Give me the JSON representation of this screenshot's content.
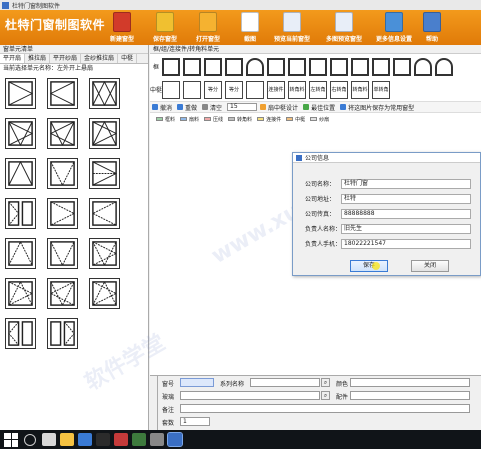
{
  "window": {
    "title": "杜特门窗制图软件"
  },
  "header": {
    "brand": "杜特门窗制图软件",
    "buttons": [
      {
        "label": "新建窗型",
        "color": "#d23b2a",
        "icon": "new-file-icon"
      },
      {
        "label": "保存窗型",
        "color": "#f0c030",
        "icon": "save-icon"
      },
      {
        "label": "打开窗型",
        "color": "#f5b230",
        "icon": "folder-icon"
      },
      {
        "label": "截图",
        "color": "#ffffff",
        "icon": "screenshot-icon"
      },
      {
        "label": "预览当前窗型",
        "color": "#e8eef8",
        "icon": "preview-icon"
      },
      {
        "label": "多图预览窗型",
        "color": "#e8eef8",
        "icon": "multi-preview-icon"
      },
      {
        "label": "更多信息设置",
        "color": "#4a90d8",
        "icon": "settings-icon"
      },
      {
        "label": "帮助",
        "color": "#4a7fcc",
        "icon": "help-icon"
      }
    ]
  },
  "left_panel": {
    "header": "窗单元清单",
    "tabs": [
      "平开扇",
      "推拉扇",
      "平开纱扇",
      "金纱推拉扇",
      "中梃"
    ],
    "caption": "当前选择单元名称：左外开上悬扇"
  },
  "right_area": {
    "header": "框/组/连接件/转角料单元",
    "row1_label": "框",
    "row2_label": "中梃",
    "shapes_row2": [
      "",
      "",
      "等分",
      "等分",
      "",
      "连接件",
      "转角料",
      "左转角",
      "右转角",
      "转角料",
      "单转角"
    ],
    "toolbar": {
      "undo": "撤消",
      "redo": "重做",
      "clear": "清空",
      "zoom": "15",
      "middle_design": "扇中梃设计",
      "best_position": "最佳位置",
      "save_as_common": "将这图片保存为常用窗型"
    },
    "legend": [
      {
        "label": "框料",
        "color": "#9fd0a8"
      },
      {
        "label": "扇料",
        "color": "#8fb8e8"
      },
      {
        "label": "压线",
        "color": "#f0a8a8"
      },
      {
        "label": "转角料",
        "color": "#c0c0c0"
      },
      {
        "label": "连接件",
        "color": "#f5e080"
      },
      {
        "label": "中梃",
        "color": "#f0c080"
      },
      {
        "label": "纱扇",
        "color": "#e0e0e0"
      }
    ]
  },
  "dialog": {
    "title": "公司信息",
    "fields": [
      {
        "label": "公司名称：",
        "value": "杜特门窗"
      },
      {
        "label": "公司地址：",
        "value": "杜特"
      },
      {
        "label": "公司传真：",
        "value": "88888888"
      },
      {
        "label": "负责人名称：",
        "value": "旧先生"
      },
      {
        "label": "负责人手机：",
        "value": "18022221547"
      }
    ],
    "save_label": "保存",
    "close_label": "关闭"
  },
  "bottom_form": {
    "window_no": "窗号",
    "series": "系列名称",
    "color": "颜色",
    "glass": "玻璃",
    "accessory": "配件",
    "note": "备注",
    "quantity": "套数",
    "quantity_value": "1"
  },
  "watermarks": [
    "www.xue51.com",
    "软件学堂"
  ]
}
